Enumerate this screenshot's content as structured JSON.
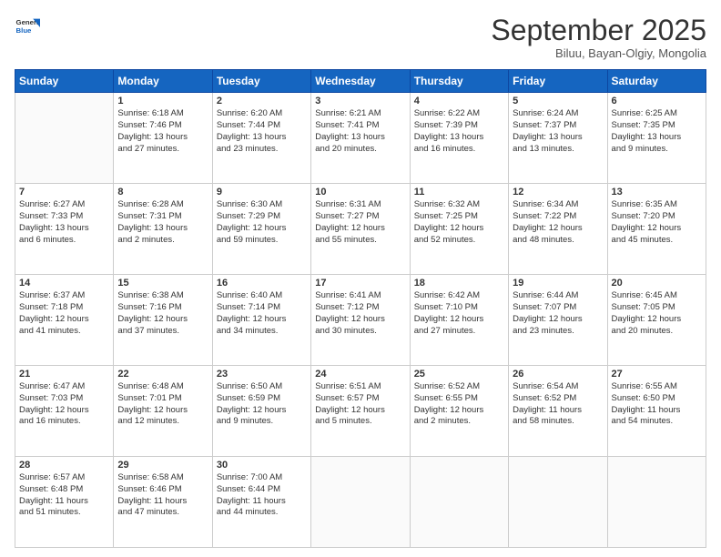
{
  "logo": {
    "line1": "General",
    "line2": "Blue"
  },
  "header": {
    "month": "September 2025",
    "location": "Biluu, Bayan-Olgiy, Mongolia"
  },
  "days_of_week": [
    "Sunday",
    "Monday",
    "Tuesday",
    "Wednesday",
    "Thursday",
    "Friday",
    "Saturday"
  ],
  "weeks": [
    [
      {
        "day": "",
        "content": ""
      },
      {
        "day": "1",
        "content": "Sunrise: 6:18 AM\nSunset: 7:46 PM\nDaylight: 13 hours\nand 27 minutes."
      },
      {
        "day": "2",
        "content": "Sunrise: 6:20 AM\nSunset: 7:44 PM\nDaylight: 13 hours\nand 23 minutes."
      },
      {
        "day": "3",
        "content": "Sunrise: 6:21 AM\nSunset: 7:41 PM\nDaylight: 13 hours\nand 20 minutes."
      },
      {
        "day": "4",
        "content": "Sunrise: 6:22 AM\nSunset: 7:39 PM\nDaylight: 13 hours\nand 16 minutes."
      },
      {
        "day": "5",
        "content": "Sunrise: 6:24 AM\nSunset: 7:37 PM\nDaylight: 13 hours\nand 13 minutes."
      },
      {
        "day": "6",
        "content": "Sunrise: 6:25 AM\nSunset: 7:35 PM\nDaylight: 13 hours\nand 9 minutes."
      }
    ],
    [
      {
        "day": "7",
        "content": "Sunrise: 6:27 AM\nSunset: 7:33 PM\nDaylight: 13 hours\nand 6 minutes."
      },
      {
        "day": "8",
        "content": "Sunrise: 6:28 AM\nSunset: 7:31 PM\nDaylight: 13 hours\nand 2 minutes."
      },
      {
        "day": "9",
        "content": "Sunrise: 6:30 AM\nSunset: 7:29 PM\nDaylight: 12 hours\nand 59 minutes."
      },
      {
        "day": "10",
        "content": "Sunrise: 6:31 AM\nSunset: 7:27 PM\nDaylight: 12 hours\nand 55 minutes."
      },
      {
        "day": "11",
        "content": "Sunrise: 6:32 AM\nSunset: 7:25 PM\nDaylight: 12 hours\nand 52 minutes."
      },
      {
        "day": "12",
        "content": "Sunrise: 6:34 AM\nSunset: 7:22 PM\nDaylight: 12 hours\nand 48 minutes."
      },
      {
        "day": "13",
        "content": "Sunrise: 6:35 AM\nSunset: 7:20 PM\nDaylight: 12 hours\nand 45 minutes."
      }
    ],
    [
      {
        "day": "14",
        "content": "Sunrise: 6:37 AM\nSunset: 7:18 PM\nDaylight: 12 hours\nand 41 minutes."
      },
      {
        "day": "15",
        "content": "Sunrise: 6:38 AM\nSunset: 7:16 PM\nDaylight: 12 hours\nand 37 minutes."
      },
      {
        "day": "16",
        "content": "Sunrise: 6:40 AM\nSunset: 7:14 PM\nDaylight: 12 hours\nand 34 minutes."
      },
      {
        "day": "17",
        "content": "Sunrise: 6:41 AM\nSunset: 7:12 PM\nDaylight: 12 hours\nand 30 minutes."
      },
      {
        "day": "18",
        "content": "Sunrise: 6:42 AM\nSunset: 7:10 PM\nDaylight: 12 hours\nand 27 minutes."
      },
      {
        "day": "19",
        "content": "Sunrise: 6:44 AM\nSunset: 7:07 PM\nDaylight: 12 hours\nand 23 minutes."
      },
      {
        "day": "20",
        "content": "Sunrise: 6:45 AM\nSunset: 7:05 PM\nDaylight: 12 hours\nand 20 minutes."
      }
    ],
    [
      {
        "day": "21",
        "content": "Sunrise: 6:47 AM\nSunset: 7:03 PM\nDaylight: 12 hours\nand 16 minutes."
      },
      {
        "day": "22",
        "content": "Sunrise: 6:48 AM\nSunset: 7:01 PM\nDaylight: 12 hours\nand 12 minutes."
      },
      {
        "day": "23",
        "content": "Sunrise: 6:50 AM\nSunset: 6:59 PM\nDaylight: 12 hours\nand 9 minutes."
      },
      {
        "day": "24",
        "content": "Sunrise: 6:51 AM\nSunset: 6:57 PM\nDaylight: 12 hours\nand 5 minutes."
      },
      {
        "day": "25",
        "content": "Sunrise: 6:52 AM\nSunset: 6:55 PM\nDaylight: 12 hours\nand 2 minutes."
      },
      {
        "day": "26",
        "content": "Sunrise: 6:54 AM\nSunset: 6:52 PM\nDaylight: 11 hours\nand 58 minutes."
      },
      {
        "day": "27",
        "content": "Sunrise: 6:55 AM\nSunset: 6:50 PM\nDaylight: 11 hours\nand 54 minutes."
      }
    ],
    [
      {
        "day": "28",
        "content": "Sunrise: 6:57 AM\nSunset: 6:48 PM\nDaylight: 11 hours\nand 51 minutes."
      },
      {
        "day": "29",
        "content": "Sunrise: 6:58 AM\nSunset: 6:46 PM\nDaylight: 11 hours\nand 47 minutes."
      },
      {
        "day": "30",
        "content": "Sunrise: 7:00 AM\nSunset: 6:44 PM\nDaylight: 11 hours\nand 44 minutes."
      },
      {
        "day": "",
        "content": ""
      },
      {
        "day": "",
        "content": ""
      },
      {
        "day": "",
        "content": ""
      },
      {
        "day": "",
        "content": ""
      }
    ]
  ]
}
